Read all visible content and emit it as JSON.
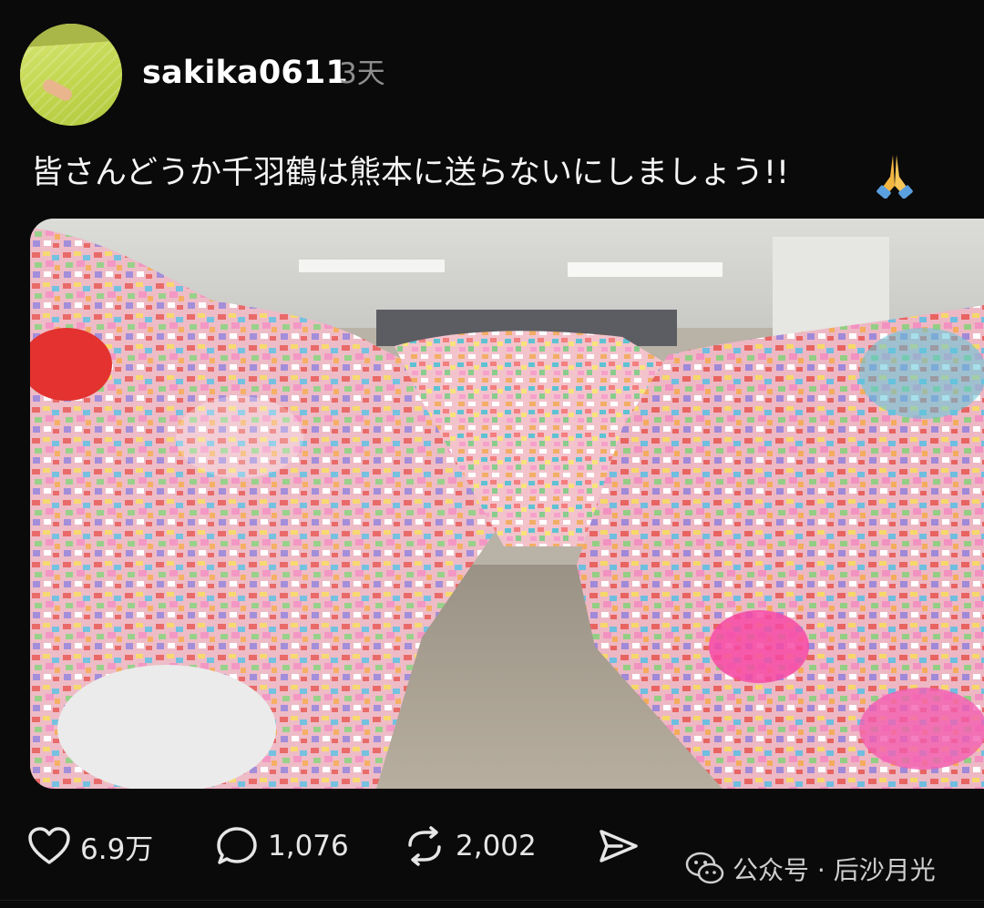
{
  "post": {
    "username": "sakika0611",
    "time_ago": "3天",
    "caption": "皆さんどうか千羽鶴は熊本に送らないにしましょう!!",
    "caption_emoji": "pray-icon"
  },
  "photo": {
    "subject": "warehouse-with-bags-of-paper-cranes"
  },
  "actions": {
    "like_count": "6.9万",
    "reply_count": "1,076",
    "repost_count": "2,002"
  },
  "watermark": {
    "text": "公众号 · 后沙月光",
    "icon": "wechat-icon"
  },
  "colors": {
    "background": "#0a0a0a",
    "text": "#ffffff",
    "muted": "#8e8e8e"
  }
}
